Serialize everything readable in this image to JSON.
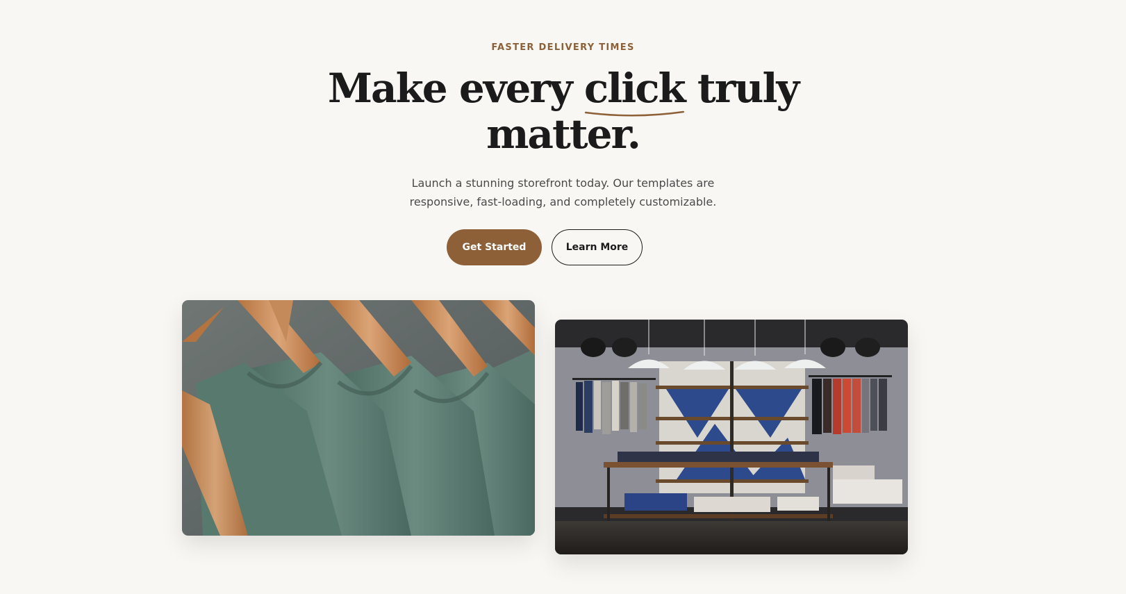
{
  "hero": {
    "eyebrow": "FASTER DELIVERY TIMES",
    "headline": {
      "before": "Make every ",
      "highlight": "click",
      "after": " truly",
      "line2": "matter."
    },
    "subtitle": {
      "line1": "Launch a stunning storefront today. Our templates are",
      "line2": "responsive, fast-loading, and completely customizable."
    },
    "primary_button": "Get Started",
    "secondary_button": "Learn More"
  },
  "colors": {
    "accent": "#8d6038",
    "background": "#f9f7f3",
    "text": "#1b1b1b",
    "muted_text": "#4a4a4a"
  },
  "gallery": {
    "images": [
      {
        "subject": "green t-shirts on wooden hangers"
      },
      {
        "subject": "clothing store interior with shelves and pendant lamps"
      }
    ]
  }
}
